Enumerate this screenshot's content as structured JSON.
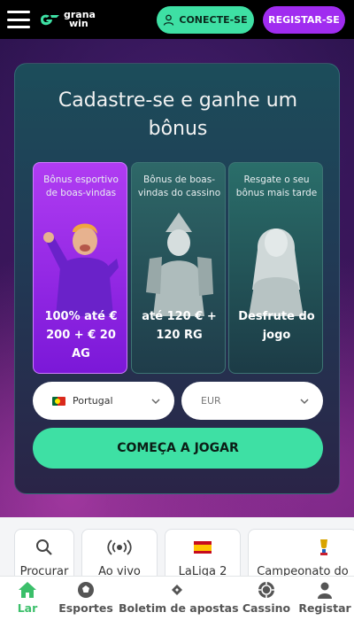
{
  "header": {
    "logo_text_line1": "grana",
    "logo_text_line2": "win",
    "connect_label": "CONECTE-SE",
    "register_label": "REGISTAR-SE"
  },
  "signup": {
    "title": "Cadastre-se e ganhe um bônus",
    "bonuses": [
      {
        "top": "Bônus esportivo de boas-vindas",
        "bottom": "100% até € 200 + € 20 AG",
        "selected": true
      },
      {
        "top": "Bônus de boas-vindas do cassino",
        "bottom": "até 120 € + 120 RG",
        "selected": false
      },
      {
        "top": "Resgate o seu bônus mais tarde",
        "bottom": "Desfrute do jogo",
        "selected": false
      }
    ],
    "country": {
      "value": "Portugal",
      "flag": "portugal-flag"
    },
    "currency": {
      "value": "EUR"
    },
    "cta_label": "COMEÇA A JOGAR"
  },
  "quick_links": [
    {
      "label": "Procurar",
      "icon": "search-icon"
    },
    {
      "label": "Ao vivo",
      "icon": "live-broadcast-icon"
    },
    {
      "label": "LaLiga 2",
      "icon": "spain-flag-icon"
    },
    {
      "label": "Campeonato do",
      "icon": "trophy-icon"
    }
  ],
  "bottom_nav": [
    {
      "label": "Lar",
      "icon": "home-icon",
      "active": true
    },
    {
      "label": "Esportes",
      "icon": "soccer-ball-icon",
      "active": false
    },
    {
      "label": "Boletim de apostas",
      "icon": "bet-slip-icon",
      "active": false
    },
    {
      "label": "Cassino",
      "icon": "casino-chip-icon",
      "active": false
    },
    {
      "label": "Registar",
      "icon": "user-icon",
      "active": false
    }
  ],
  "colors": {
    "accent_green": "#3ee0a4",
    "accent_purple": "#a02cf0",
    "active_nav": "#3bbf6a"
  }
}
